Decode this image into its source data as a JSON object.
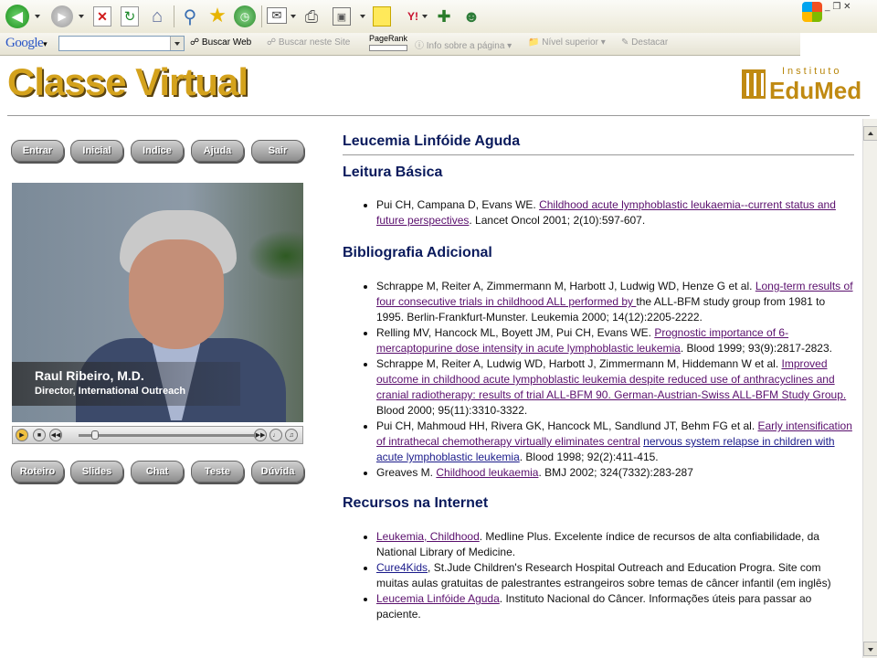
{
  "browser": {
    "google_label": "Google",
    "search_web": "Buscar Web",
    "search_site": "Buscar neste Site",
    "pagerank": "PageRank",
    "page_info": "Info sobre a página",
    "up_level": "Nível superior",
    "highlight": "Destacar"
  },
  "header": {
    "title": "Classe Virtual",
    "logo_top": "Instituto",
    "logo_name": "EduMed"
  },
  "nav_top": [
    "Entrar",
    "Inicial",
    "Indice",
    "Ajuda",
    "Sair"
  ],
  "nav_bottom": [
    "Roteiro",
    "Slides",
    "Chat",
    "Teste",
    "Dúvida"
  ],
  "video": {
    "name": "Raul Ribeiro, M.D.",
    "role": "Director, International Outreach"
  },
  "content": {
    "title": "Leucemia Linfóide Aguda",
    "basic": {
      "heading": "Leitura Básica",
      "items": [
        {
          "pre": "Pui CH, Campana D, Evans WE. ",
          "link": "Childhood acute lymphoblastic leukaemia--current status and future perspectives",
          "post": ". Lancet Oncol 2001; 2(10):597-607."
        }
      ]
    },
    "additional": {
      "heading": "Bibliografia Adicional",
      "items": [
        {
          "pre": "Schrappe M, Reiter A, Zimmermann M, Harbott J, Ludwig WD, Henze G et al. ",
          "link": "Long-term results of four consecutive trials in childhood ALL performed by ",
          "post": "the ALL-BFM study group from 1981 to 1995. Berlin-Frankfurt-Munster. Leukemia 2000; 14(12):2205-2222."
        },
        {
          "pre": "Relling MV, Hancock ML, Boyett JM, Pui CH, Evans WE. ",
          "link": "Prognostic importance of 6-mercaptopurine dose intensity in acute lymphoblastic leukemia",
          "post": ". Blood 1999; 93(9):2817-2823."
        },
        {
          "pre": " Schrappe M, Reiter A, Ludwig WD, Harbott J, Zimmermann M, Hiddemann W et al. ",
          "link": "Improved outcome in childhood acute lymphoblastic leukemia despite reduced use of anthracyclines and cranial radiotherapy: results of trial ALL-BFM 90. German-Austrian-Swiss ALL-BFM Study Group.",
          "post": " Blood 2000; 95(11):3310-3322."
        },
        {
          "pre": "Pui CH, Mahmoud HH, Rivera GK, Hancock ML, Sandlund JT, Behm FG et al. ",
          "link": "Early intensification of intrathecal chemotherapy virtually eliminates central",
          "link2": "nervous system relapse in children with acute lymphoblastic leukemia",
          "post": ". Blood 1998; 92(2):411-415."
        },
        {
          "pre": "Greaves M. ",
          "link": "Childhood leukaemia",
          "post": ". BMJ 2002; 324(7332):283-287"
        }
      ]
    },
    "internet": {
      "heading": "Recursos na Internet",
      "items": [
        {
          "link": "Leukemia, Childhood",
          "post": ". Medline Plus. Excelente índice de recursos de alta confiabilidade, da National Library of Medicine."
        },
        {
          "link": "Cure4Kids",
          "post": ", St.Jude Children's Research Hospital Outreach and Education Progra. Site com muitas aulas gratuitas de palestrantes estrangeiros sobre temas de câncer infantil (em inglês)"
        },
        {
          "link": "Leucemia Linfóide Aguda",
          "post": ". Instituto Nacional do Câncer. Informações úteis para passar ao paciente."
        }
      ]
    }
  }
}
